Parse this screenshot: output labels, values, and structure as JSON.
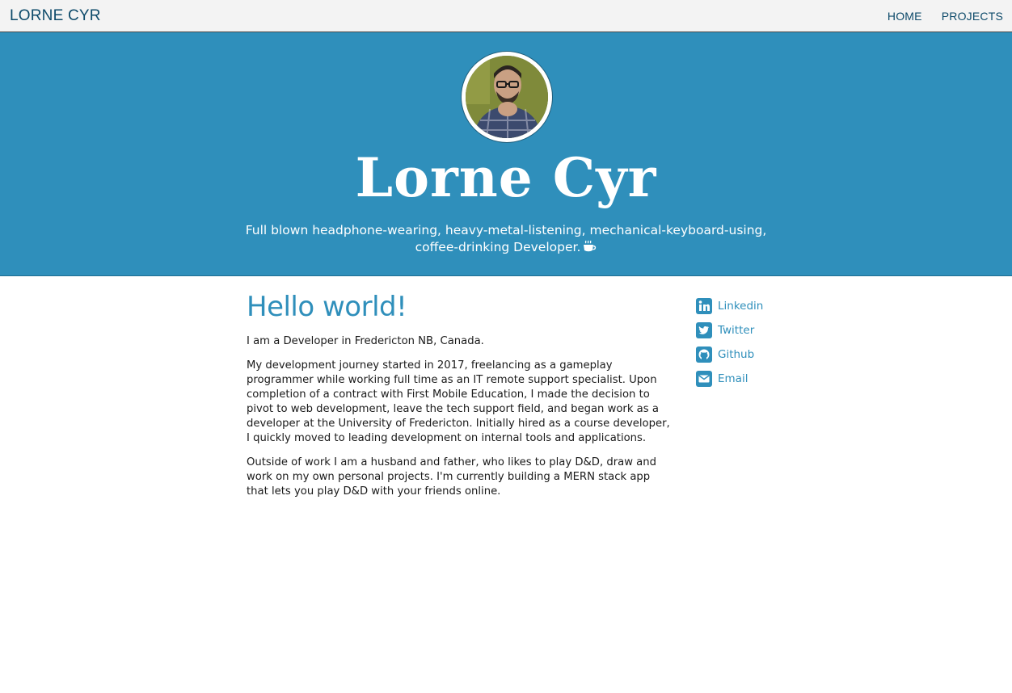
{
  "header": {
    "brand": "LORNE CYR",
    "nav": [
      "HOME",
      "PROJECTS"
    ]
  },
  "hero": {
    "name": "Lorne Cyr",
    "tagline_line1": "Full blown headphone-wearing, heavy-metal-listening, mechanical-keyboard-using,",
    "tagline_line2": "coffee-drinking Developer.",
    "tagline_icon": "coffee-cup-icon"
  },
  "main": {
    "heading": "Hello world!",
    "paragraphs": [
      "I am a Developer in Fredericton NB, Canada.",
      "My development journey started in 2017, freelancing as a gameplay programmer while working full time as an IT remote support specialist. Upon completion of a contract with First Mobile Education, I made the decision to pivot to web development, leave the tech support field, and began work as a developer at the University of Fredericton. Initially hired as a course developer, I quickly moved to leading development on internal tools and applications.",
      "Outside of work I am a husband and father, who likes to play D&D, draw and work on my own personal projects. I'm currently building a MERN stack app that lets you play D&D with your friends online."
    ]
  },
  "social": [
    {
      "label": "Linkedin",
      "icon": "linkedin-icon"
    },
    {
      "label": "Twitter",
      "icon": "twitter-icon"
    },
    {
      "label": "Github",
      "icon": "github-icon"
    },
    {
      "label": "Email",
      "icon": "email-icon"
    }
  ],
  "colors": {
    "accent": "#2f8fbb",
    "nav_text": "#0d4a6a",
    "topbar_bg": "#f3f3f3"
  }
}
